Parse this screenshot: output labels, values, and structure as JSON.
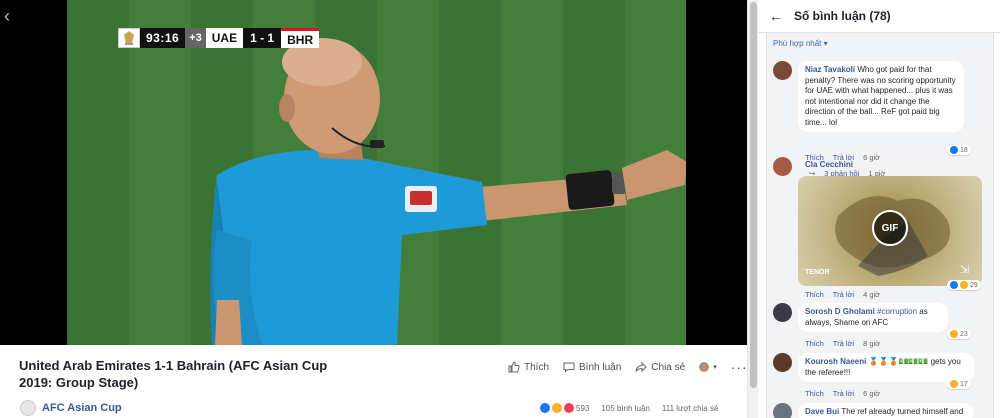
{
  "scorebug": {
    "clock": "93:16",
    "added_time": "+3",
    "home": "UAE",
    "score": "1 - 1",
    "away": "BHR"
  },
  "video": {
    "title": "United Arab Emirates 1-1 Bahrain (AFC Asian Cup 2019: Group Stage)"
  },
  "actions": {
    "like": "Thích",
    "comment": "Bình luận",
    "share": "Chia sẻ"
  },
  "page": {
    "name": "AFC Asian Cup"
  },
  "stats": {
    "reactions": "593",
    "comments": "105 bình luận",
    "shares": "111 lượt chia sẻ"
  },
  "panel": {
    "title": "Số bình luận (78)",
    "sort": "Phù hợp nhất ▾"
  },
  "comments": [
    {
      "name": "Niaz Tavakoli",
      "text": "Who got paid for that penalty? There was no scoring opportunity for UAE with what happened... plus it was not intentional nor did it change the direction of the ball... ReF got paid big time... lol",
      "like": "Thích",
      "reply": "Trả lời",
      "time": "6 giờ",
      "reactions": "18",
      "replies": "3 phản hồi",
      "replies_time": "1 giờ"
    },
    {
      "name": "Cla Cecchini",
      "gif_label": "GIF",
      "gif_source": "TENOR",
      "like": "Thích",
      "reply": "Trả lời",
      "time": "4 giờ",
      "reactions": "29"
    },
    {
      "name": "Sorosh D Gholami",
      "tag": "#corruption",
      "text": " as always, Shame on AFC",
      "like": "Thích",
      "reply": "Trả lời",
      "time": "8 giờ",
      "reactions": "23"
    },
    {
      "name": "Kourosh Naeeni",
      "text": "🥉🥉🥉💵💵💵 gets you the referee!!!",
      "like": "Thích",
      "reply": "Trả lời",
      "time": "6 giờ",
      "reactions": "17"
    },
    {
      "name": "Dave Bui",
      "text": "The ref already turned himself and"
    }
  ],
  "colors": {
    "link": "#385898",
    "accent": "#4267b2",
    "panel_bg": "#f2f3f5",
    "pitch": "#3e7a37",
    "referee_shirt": "#1e9bd7"
  }
}
